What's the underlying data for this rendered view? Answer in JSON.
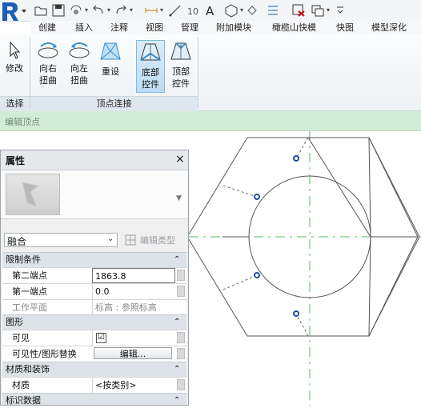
{
  "ribbon_tabs": [
    "创建",
    "插入",
    "注释",
    "视图",
    "管理",
    "附加模块",
    "橄榄山快模",
    "快图",
    "模型深化"
  ],
  "ribbon": {
    "modify_label": "修改",
    "twist_right_label": "向右\n扭曲",
    "twist_left_label": "向左\n扭曲",
    "reset_label": "重设",
    "bottom_control_label": "底部\n控件",
    "top_control_label": "顶部\n控件",
    "panel_select": "选择",
    "panel_vertex_connect": "顶点连接"
  },
  "context_bar": {
    "label": "编辑顶点"
  },
  "properties": {
    "title": "属性",
    "close_glyph": "×",
    "type_name": "融合",
    "edit_type_label": "编辑类型",
    "groups": {
      "constraints": "限制条件",
      "graphics": "图形",
      "materials": "材质和装饰",
      "identity": "标识数据"
    },
    "rows": {
      "second_end": {
        "label": "第二端点",
        "value": "1863.8"
      },
      "first_end": {
        "label": "第一端点",
        "value": "0.0"
      },
      "work_plane": {
        "label": "工作平面",
        "value": "标高 : 参照标高"
      },
      "visible": {
        "label": "可见",
        "value": "☑"
      },
      "vis_override": {
        "label": "可见性/图形替换",
        "value": "编辑..."
      },
      "material": {
        "label": "材质",
        "value": "<按类别>"
      }
    },
    "collapse_glyph": "⌃"
  },
  "colors": {
    "accent_blue": "#1a5fb4",
    "context_green": "#d3ecd7",
    "ref_line_green": "#5cb85c",
    "vertex_blue": "#1f4fa0"
  },
  "icons": [
    "app-logo-icon",
    "open-icon",
    "save-icon",
    "sync-icon",
    "undo-icon",
    "redo-icon",
    "measure-icon",
    "dimension-icon",
    "tag-icon",
    "text-icon",
    "3d-view-icon",
    "section-icon",
    "thin-lines-icon",
    "close-hidden-icon",
    "switch-windows-icon",
    "customize-icon",
    "modify-cursor-icon",
    "twist-right-icon",
    "twist-left-icon",
    "reset-icon",
    "bottom-control-icon",
    "top-control-icon",
    "edit-type-icon"
  ]
}
